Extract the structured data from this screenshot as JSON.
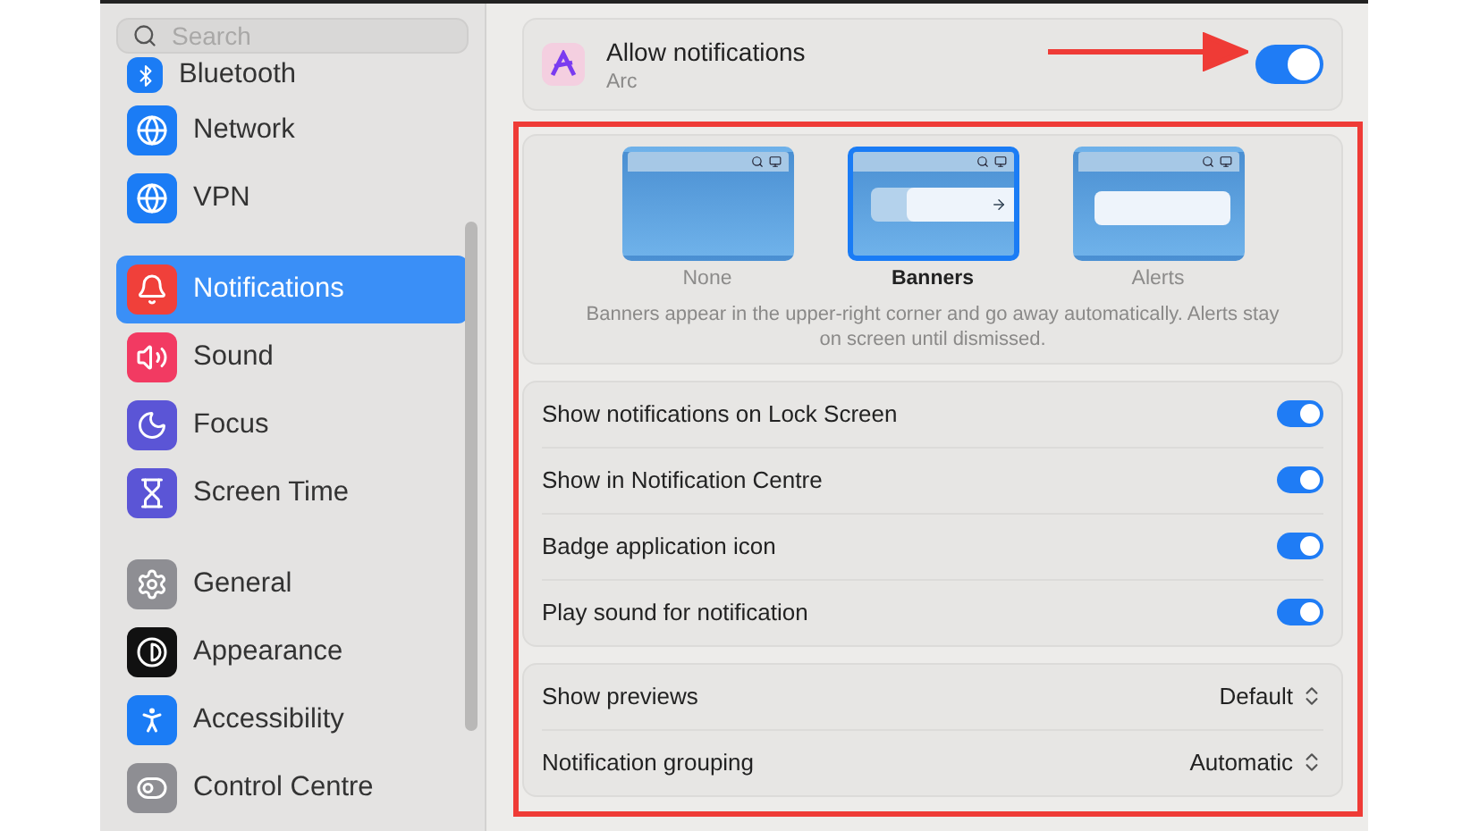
{
  "search": {
    "placeholder": "Search"
  },
  "sidebar": {
    "groups": [
      [
        {
          "label": "Bluetooth",
          "kind": "bluetooth",
          "selected": false
        },
        {
          "label": "Network",
          "kind": "network",
          "selected": false
        },
        {
          "label": "VPN",
          "kind": "vpn",
          "selected": false
        }
      ],
      [
        {
          "label": "Notifications",
          "kind": "notifications",
          "selected": true
        },
        {
          "label": "Sound",
          "kind": "sound",
          "selected": false
        },
        {
          "label": "Focus",
          "kind": "focus",
          "selected": false
        },
        {
          "label": "Screen Time",
          "kind": "screen_time",
          "selected": false
        }
      ],
      [
        {
          "label": "General",
          "kind": "general",
          "selected": false
        },
        {
          "label": "Appearance",
          "kind": "appearance",
          "selected": false
        },
        {
          "label": "Accessibility",
          "kind": "accessibility",
          "selected": false
        },
        {
          "label": "Control Centre",
          "kind": "control_centre",
          "selected": false
        }
      ]
    ]
  },
  "header": {
    "title": "Allow notifications",
    "app": "Arc",
    "on": true
  },
  "styles": [
    {
      "label": "None",
      "kind": "none",
      "selected": false
    },
    {
      "label": "Banners",
      "kind": "banners",
      "selected": true
    },
    {
      "label": "Alerts",
      "kind": "alerts",
      "selected": false
    }
  ],
  "description": "Banners appear in the upper-right corner and go away automatically. Alerts stay on screen until dismissed.",
  "toggles": [
    {
      "label": "Show notifications on Lock Screen",
      "on": true
    },
    {
      "label": "Show in Notification Centre",
      "on": true
    },
    {
      "label": "Badge application icon",
      "on": true
    },
    {
      "label": "Play sound for notification",
      "on": true
    }
  ],
  "popups": [
    {
      "label": "Show previews",
      "value": "Default"
    },
    {
      "label": "Notification grouping",
      "value": "Automatic"
    }
  ],
  "annotations": {
    "arrow": true,
    "frame": true
  }
}
